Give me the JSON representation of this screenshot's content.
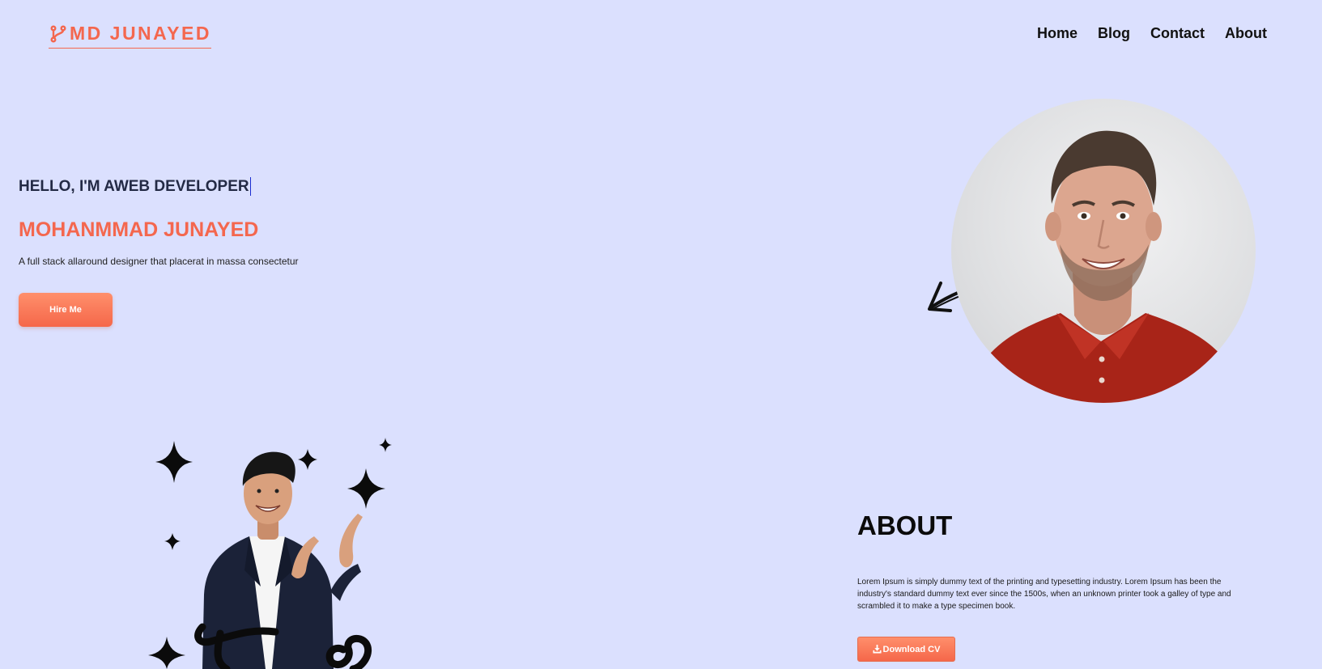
{
  "header": {
    "logo_text": "MD JUNAYED",
    "logo_icon": "branch-icon",
    "nav": [
      {
        "label": "Home"
      },
      {
        "label": "Blog"
      },
      {
        "label": "Contact"
      },
      {
        "label": "About"
      }
    ]
  },
  "hero": {
    "greeting": "HELLO, I'M AWEB DEVELOPER",
    "name": "MOHANMMAD JUNAYED",
    "subtitle": "A full stack allaround designer that placerat in massa consectetur",
    "hire_button": "Hire Me"
  },
  "about": {
    "title": "ABOUT",
    "body": "Lorem Ipsum is simply dummy text of the printing and typesetting industry. Lorem Ipsum has been the industry's standard dummy text ever since the 1500s, when an unknown printer took a galley of type and scrambled it to make a type specimen book.",
    "download_button": "Download CV",
    "download_icon": "download-icon"
  },
  "colors": {
    "background": "#dbe0fe",
    "accent": "#f4674e",
    "text_dark": "#232a45"
  }
}
